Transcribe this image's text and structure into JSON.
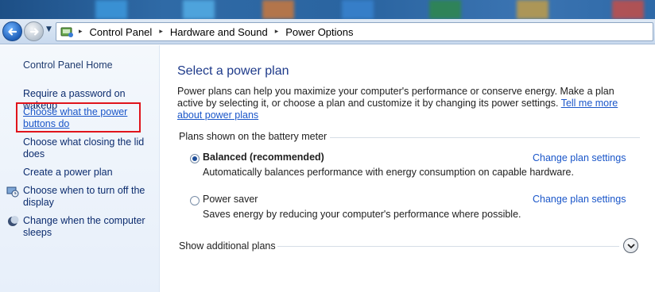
{
  "colors": {
    "link": "#1a56c9",
    "title": "#1e3a8a",
    "highlight_box": "#e0141b",
    "left_pane_bg": "#eaf1fa"
  },
  "navigation": {
    "back_icon": "back-arrow-icon",
    "forward_icon": "forward-arrow-icon",
    "recent_pages_icon": "chevron-down-icon",
    "breadcrumb_icon": "control-panel-icon",
    "breadcrumbs": [
      "Control Panel",
      "Hardware and Sound",
      "Power Options"
    ]
  },
  "sidebar": {
    "home": "Control Panel Home",
    "items": [
      {
        "label": "Require a password on wakeup",
        "icon": null
      },
      {
        "label": "Choose what the power buttons do",
        "icon": null,
        "active": true
      },
      {
        "label": "Choose what closing the lid does",
        "icon": null
      },
      {
        "label": "Create a power plan",
        "icon": null
      },
      {
        "label": "Choose when to turn off the display",
        "icon": "display-schedule-icon"
      },
      {
        "label": "Change when the computer sleeps",
        "icon": "sleep-moon-icon"
      }
    ]
  },
  "main": {
    "title": "Select a power plan",
    "description": "Power plans can help you maximize your computer's performance or conserve energy. Make a plan active by selecting it, or choose a plan and customize it by changing its power settings.",
    "tell_me_more": "Tell me more about power plans",
    "section_label": "Plans shown on the battery meter",
    "plans": [
      {
        "name": "Balanced (recommended)",
        "selected": true,
        "description": "Automatically balances performance with energy consumption on capable hardware.",
        "action": "Change plan settings"
      },
      {
        "name": "Power saver",
        "selected": false,
        "description": "Saves energy by reducing your computer's performance where possible.",
        "action": "Change plan settings"
      }
    ],
    "show_additional": "Show additional plans",
    "expand_icon": "chevron-down-circle-icon"
  }
}
